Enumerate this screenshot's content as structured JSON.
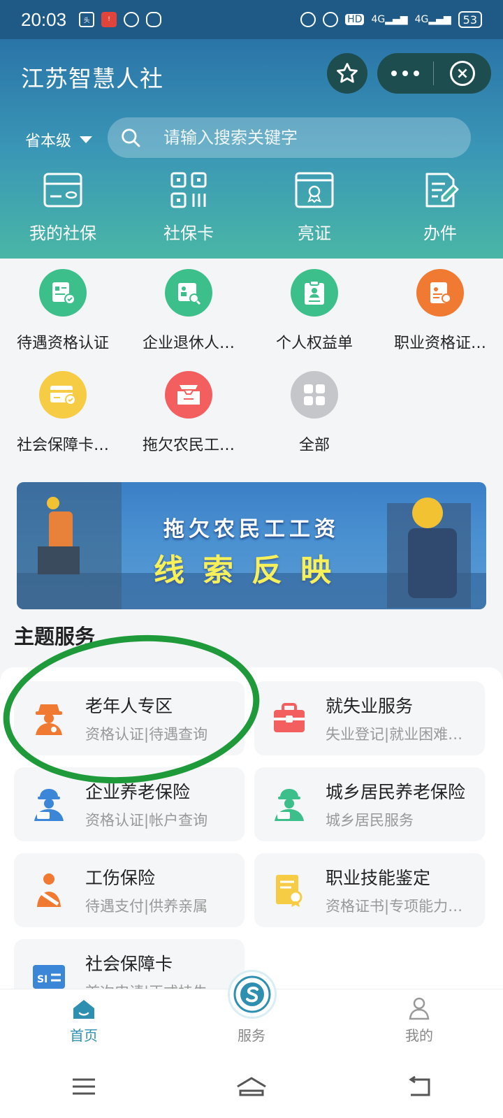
{
  "status_bar": {
    "time": "20:03",
    "left_icons": [
      "toutiao-icon",
      "notification-icon",
      "alarm-icon",
      "wechat-icon"
    ],
    "network_1": "4G",
    "network_2": "4G",
    "hd": "HD",
    "battery": "53"
  },
  "header": {
    "title": "江苏智慧人社",
    "region": "省本级",
    "search_placeholder": "请输入搜索关键字"
  },
  "quick_actions": [
    {
      "label": "我的社保",
      "icon": "card-icon"
    },
    {
      "label": "社保卡",
      "icon": "qr-code-icon"
    },
    {
      "label": "亮证",
      "icon": "certificate-icon"
    },
    {
      "label": "办件",
      "icon": "edit-document-icon"
    }
  ],
  "services": [
    {
      "label": "待遇资格认证",
      "color": "#3dbf8b",
      "icon": "verify-doc-icon"
    },
    {
      "label": "企业退休人…",
      "color": "#3dbf8b",
      "icon": "retiree-search-icon"
    },
    {
      "label": "个人权益单",
      "color": "#3dbf8b",
      "icon": "clipboard-user-icon"
    },
    {
      "label": "职业资格证…",
      "color": "#f07a32",
      "icon": "certificate-search-icon"
    },
    {
      "label": "社会保障卡…",
      "color": "#f6cc45",
      "icon": "card-check-icon"
    },
    {
      "label": "拖欠农民工…",
      "color": "#f35f5f",
      "icon": "inbox-icon"
    },
    {
      "label": "全部",
      "color": "#c4c6c9",
      "icon": "grid-icon"
    }
  ],
  "banner": {
    "line1": "拖欠农民工工资",
    "line2": "线索反映"
  },
  "theme_section": {
    "title": "主题服务",
    "cards": [
      {
        "title": "老年人专区",
        "subtitle": "资格认证|待遇查询",
        "icon": "elderly-icon",
        "color": "#f07a32"
      },
      {
        "title": "就失业服务",
        "subtitle": "失业登记|就业困难…",
        "icon": "briefcase-icon",
        "color": "#f35f5f"
      },
      {
        "title": "企业养老保险",
        "subtitle": "资格认证|帐户查询",
        "icon": "enterprise-worker-icon",
        "color": "#3b86d6"
      },
      {
        "title": "城乡居民养老保险",
        "subtitle": "城乡居民服务",
        "icon": "resident-worker-icon",
        "color": "#3dbf8b"
      },
      {
        "title": "工伤保险",
        "subtitle": "待遇支付|供养亲属",
        "icon": "injury-icon",
        "color": "#f07a32"
      },
      {
        "title": "职业技能鉴定",
        "subtitle": "资格证书|专项能力…",
        "icon": "skill-certificate-icon",
        "color": "#f6cc45"
      },
      {
        "title": "社会保障卡",
        "subtitle": "首次申请|正式挂失",
        "icon": "social-security-card-icon",
        "color": "#3b86d6"
      }
    ]
  },
  "tab_bar": {
    "tabs": [
      {
        "label": "首页",
        "icon": "home-icon",
        "active": true
      },
      {
        "label": "服务",
        "icon": "service-logo-icon",
        "active": false
      },
      {
        "label": "我的",
        "icon": "user-icon",
        "active": false
      }
    ]
  },
  "system_nav": [
    "menu-icon",
    "home-nav-icon",
    "back-icon"
  ]
}
